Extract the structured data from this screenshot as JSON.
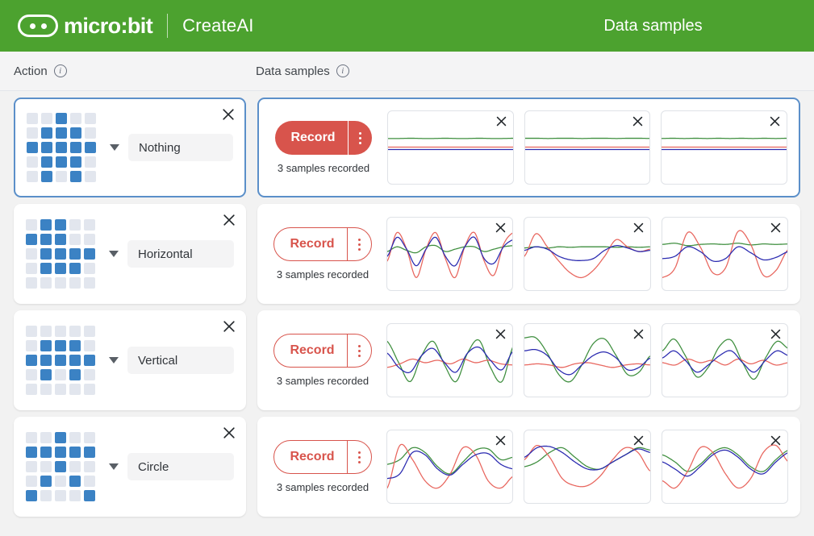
{
  "header": {
    "brand_name": "micro:bit",
    "brand_sub": "CreateAI",
    "page_title": "Data samples",
    "logo_icon": "microbit-logo-icon",
    "bg_color": "#4ca22f"
  },
  "columns": {
    "action_label": "Action",
    "samples_label": "Data samples",
    "info_icon": "info-icon",
    "info_glyph": "i"
  },
  "colors": {
    "led_on": "#3b82c4",
    "led_off": "#e2e6ee",
    "record_red": "#d8544c",
    "selected_border": "#5b8fc9",
    "trace_x": "#e8665e",
    "trace_y": "#3f8f3f",
    "trace_z": "#2a2ab0"
  },
  "close_icon": "close-icon",
  "menu_icon": "kebab-menu-icon",
  "caret_icon": "chevron-down-icon",
  "rows": [
    {
      "label": "Nothing",
      "selected": true,
      "record_label": "Record",
      "record_style": "filled",
      "samples_count": "3 samples recorded",
      "led": [
        [
          0,
          0,
          1,
          0,
          0
        ],
        [
          0,
          1,
          1,
          1,
          0
        ],
        [
          1,
          1,
          1,
          1,
          1
        ],
        [
          0,
          1,
          1,
          1,
          0
        ],
        [
          0,
          1,
          0,
          1,
          0
        ]
      ],
      "samples": [
        {
          "type": "flat"
        },
        {
          "type": "flat"
        },
        {
          "type": "flat"
        }
      ]
    },
    {
      "label": "Horizontal",
      "selected": false,
      "record_label": "Record",
      "record_style": "outline",
      "samples_count": "3 samples recorded",
      "led": [
        [
          0,
          1,
          1,
          0,
          0
        ],
        [
          1,
          1,
          1,
          0,
          0
        ],
        [
          0,
          1,
          1,
          1,
          1
        ],
        [
          0,
          1,
          1,
          1,
          0
        ],
        [
          0,
          0,
          0,
          0,
          0
        ]
      ],
      "samples": [
        {
          "type": "wave",
          "variant": 1
        },
        {
          "type": "wave",
          "variant": 2
        },
        {
          "type": "wave",
          "variant": 3
        }
      ]
    },
    {
      "label": "Vertical",
      "selected": false,
      "record_label": "Record",
      "record_style": "outline",
      "samples_count": "3 samples recorded",
      "led": [
        [
          0,
          0,
          0,
          0,
          0
        ],
        [
          0,
          1,
          1,
          1,
          0
        ],
        [
          1,
          1,
          1,
          1,
          1
        ],
        [
          0,
          1,
          0,
          1,
          0
        ],
        [
          0,
          0,
          0,
          0,
          0
        ]
      ],
      "samples": [
        {
          "type": "wave",
          "variant": 4
        },
        {
          "type": "wave",
          "variant": 5
        },
        {
          "type": "wave",
          "variant": 6
        }
      ]
    },
    {
      "label": "Circle",
      "selected": false,
      "record_label": "Record",
      "record_style": "outline",
      "samples_count": "3 samples recorded",
      "led": [
        [
          0,
          0,
          1,
          0,
          0
        ],
        [
          1,
          1,
          1,
          1,
          1
        ],
        [
          0,
          0,
          1,
          0,
          0
        ],
        [
          0,
          1,
          0,
          1,
          0
        ],
        [
          1,
          0,
          0,
          0,
          1
        ]
      ],
      "samples": [
        {
          "type": "wave",
          "variant": 7
        },
        {
          "type": "wave",
          "variant": 8
        },
        {
          "type": "wave",
          "variant": 9
        }
      ]
    }
  ],
  "chart_data": {
    "type": "line",
    "description": "Accelerometer sample traces, three axes per sample card",
    "series_names": [
      "x",
      "y",
      "z"
    ],
    "series_colors": [
      "#e8665e",
      "#3f8f3f",
      "#2a2ab0"
    ],
    "xlabel": "",
    "ylabel": "",
    "grid": false,
    "legend": "none",
    "cards": [
      {
        "row": "Nothing",
        "index": 0,
        "series": [
          {
            "name": "x",
            "values": [
              0.02,
              0.02,
              0.02,
              0.02,
              0.02,
              0.02,
              0.02,
              0.02,
              0.02,
              0.02,
              0.02,
              0.02
            ]
          },
          {
            "name": "y",
            "values": [
              0.44,
              0.44,
              0.45,
              0.44,
              0.44,
              0.45,
              0.44,
              0.44,
              0.45,
              0.44,
              0.44,
              0.45
            ]
          },
          {
            "name": "z",
            "values": [
              -0.1,
              -0.1,
              -0.1,
              -0.1,
              -0.1,
              -0.1,
              -0.1,
              -0.1,
              -0.1,
              -0.1,
              -0.1,
              -0.1
            ]
          }
        ]
      },
      {
        "row": "Nothing",
        "index": 1,
        "series": [
          {
            "name": "x",
            "values": [
              0.02,
              0.02,
              0.02,
              0.02,
              0.02,
              0.02,
              0.02,
              0.02,
              0.02,
              0.02,
              0.02,
              0.02
            ]
          },
          {
            "name": "y",
            "values": [
              0.45,
              0.45,
              0.44,
              0.45,
              0.45,
              0.44,
              0.45,
              0.45,
              0.44,
              0.45,
              0.45,
              0.44
            ]
          },
          {
            "name": "z",
            "values": [
              -0.1,
              -0.1,
              -0.1,
              -0.1,
              -0.1,
              -0.1,
              -0.1,
              -0.1,
              -0.1,
              -0.1,
              -0.1,
              -0.1
            ]
          }
        ]
      },
      {
        "row": "Nothing",
        "index": 2,
        "series": [
          {
            "name": "x",
            "values": [
              0.02,
              0.02,
              0.02,
              0.02,
              0.02,
              0.02,
              0.02,
              0.02,
              0.02,
              0.02,
              0.02,
              0.02
            ]
          },
          {
            "name": "y",
            "values": [
              0.44,
              0.45,
              0.44,
              0.45,
              0.44,
              0.45,
              0.44,
              0.45,
              0.44,
              0.45,
              0.44,
              0.45
            ]
          },
          {
            "name": "z",
            "values": [
              -0.1,
              -0.1,
              -0.1,
              -0.1,
              -0.1,
              -0.1,
              -0.1,
              -0.1,
              -0.1,
              -0.1,
              -0.1,
              -0.1
            ]
          }
        ]
      },
      {
        "row": "Horizontal",
        "index": 0,
        "series": [
          {
            "name": "x",
            "values": [
              -0.3,
              0.9,
              0.2,
              -1.0,
              0.2,
              0.9,
              -0.2,
              -1.0,
              0.3,
              0.9,
              -0.3,
              -0.9,
              0.4,
              0.9
            ]
          },
          {
            "name": "y",
            "values": [
              0.1,
              0.3,
              0.15,
              0.05,
              0.3,
              0.35,
              0.1,
              0.2,
              0.3,
              0.3,
              0.1,
              0.2,
              0.3,
              0.35
            ]
          },
          {
            "name": "z",
            "values": [
              -0.1,
              0.7,
              0.2,
              -0.5,
              0.2,
              0.7,
              -0.1,
              -0.5,
              0.3,
              0.7,
              -0.2,
              -0.4,
              0.3,
              0.6
            ]
          }
        ]
      },
      {
        "row": "Horizontal",
        "index": 1,
        "series": [
          {
            "name": "x",
            "values": [
              -0.1,
              0.85,
              0.3,
              -0.3,
              -0.8,
              -1.0,
              -0.7,
              -0.1,
              0.6,
              0.3,
              0.1,
              0.2
            ]
          },
          {
            "name": "y",
            "values": [
              0.25,
              0.3,
              0.25,
              0.3,
              0.28,
              0.3,
              0.3,
              0.3,
              0.28,
              0.3,
              0.28,
              0.3
            ]
          },
          {
            "name": "z",
            "values": [
              0.15,
              0.3,
              0.2,
              -0.1,
              -0.25,
              -0.28,
              -0.2,
              0.15,
              0.35,
              0.25,
              0.1,
              0.15
            ]
          }
        ]
      },
      {
        "row": "Horizontal",
        "index": 2,
        "series": [
          {
            "name": "x",
            "values": [
              -1.0,
              -0.6,
              0.9,
              0.3,
              -0.8,
              -0.6,
              0.95,
              0.4,
              -0.9,
              -0.7,
              0.2
            ]
          },
          {
            "name": "y",
            "values": [
              0.4,
              0.45,
              0.35,
              0.4,
              0.42,
              0.4,
              0.45,
              0.38,
              0.42,
              0.4,
              0.42
            ]
          },
          {
            "name": "z",
            "values": [
              -0.2,
              -0.1,
              0.3,
              0.1,
              -0.3,
              -0.2,
              0.3,
              0.05,
              -0.25,
              -0.15,
              0.1
            ]
          }
        ]
      },
      {
        "row": "Vertical",
        "index": 0,
        "series": [
          {
            "name": "x",
            "values": [
              -0.3,
              -0.15,
              0.05,
              -0.1,
              0.0,
              -0.15,
              0.05,
              -0.1,
              0.0,
              -0.15,
              -0.2
            ]
          },
          {
            "name": "y",
            "values": [
              0.8,
              -0.1,
              -0.9,
              0.2,
              0.8,
              -0.2,
              -0.9,
              0.3,
              0.85,
              -0.3,
              -0.9,
              0.6
            ]
          },
          {
            "name": "z",
            "values": [
              0.3,
              -0.3,
              -0.5,
              0.2,
              0.5,
              -0.1,
              -0.5,
              0.3,
              0.55,
              0.0,
              -0.4,
              0.4
            ]
          }
        ]
      },
      {
        "row": "Vertical",
        "index": 1,
        "series": [
          {
            "name": "x",
            "values": [
              -0.2,
              -0.15,
              -0.2,
              -0.3,
              -0.15,
              -0.1,
              -0.2,
              -0.3,
              -0.2,
              -0.15,
              -0.2
            ]
          },
          {
            "name": "y",
            "values": [
              0.95,
              0.95,
              0.3,
              -0.6,
              -0.9,
              -0.2,
              0.7,
              0.9,
              0.2,
              -0.6,
              -0.5,
              0.2
            ]
          },
          {
            "name": "z",
            "values": [
              0.4,
              0.45,
              0.2,
              -0.4,
              -0.6,
              -0.2,
              0.2,
              0.35,
              0.1,
              -0.4,
              -0.3,
              0.1
            ]
          }
        ]
      },
      {
        "row": "Vertical",
        "index": 2,
        "series": [
          {
            "name": "x",
            "values": [
              -0.1,
              -0.2,
              0.05,
              -0.1,
              0.0,
              -0.2,
              0.05,
              -0.15,
              0.0,
              -0.2,
              -0.1
            ]
          },
          {
            "name": "y",
            "values": [
              0.4,
              0.9,
              0.2,
              -0.7,
              -0.3,
              0.6,
              0.85,
              -0.1,
              -0.8,
              0.1,
              0.8,
              0.5
            ]
          },
          {
            "name": "z",
            "values": [
              0.1,
              0.4,
              0.0,
              -0.5,
              -0.2,
              0.2,
              0.4,
              -0.1,
              -0.5,
              0.0,
              0.4,
              0.2
            ]
          }
        ]
      },
      {
        "row": "Circle",
        "index": 0,
        "series": [
          {
            "name": "x",
            "values": [
              -0.9,
              0.9,
              0.3,
              -0.6,
              -0.9,
              -0.3,
              0.8,
              0.5,
              -0.6,
              -0.9,
              -0.4
            ]
          },
          {
            "name": "y",
            "values": [
              0.1,
              0.3,
              0.8,
              0.6,
              0.0,
              -0.3,
              0.2,
              0.7,
              0.75,
              0.3,
              0.4
            ]
          },
          {
            "name": "z",
            "values": [
              -0.5,
              -0.3,
              0.6,
              0.5,
              -0.1,
              -0.35,
              0.1,
              0.5,
              0.55,
              0.1,
              -0.1
            ]
          }
        ]
      },
      {
        "row": "Circle",
        "index": 1,
        "series": [
          {
            "name": "x",
            "values": [
              0.3,
              0.9,
              0.4,
              -0.5,
              -0.8,
              -0.8,
              -0.4,
              0.3,
              0.8,
              0.6,
              -0.2
            ]
          },
          {
            "name": "y",
            "values": [
              0.0,
              0.2,
              0.6,
              0.8,
              0.4,
              0.0,
              -0.1,
              0.2,
              0.5,
              0.8,
              0.7
            ]
          },
          {
            "name": "z",
            "values": [
              0.4,
              0.8,
              0.85,
              0.6,
              0.2,
              -0.1,
              -0.1,
              0.2,
              0.5,
              0.75,
              0.6
            ]
          }
        ]
      },
      {
        "row": "Circle",
        "index": 2,
        "series": [
          {
            "name": "x",
            "values": [
              -0.6,
              -0.9,
              -0.2,
              0.8,
              0.6,
              -0.3,
              -0.9,
              -0.5,
              0.6,
              0.9,
              0.2
            ]
          },
          {
            "name": "y",
            "values": [
              0.5,
              0.2,
              -0.2,
              0.1,
              0.6,
              0.8,
              0.5,
              0.0,
              -0.2,
              0.3,
              0.7
            ]
          },
          {
            "name": "z",
            "values": [
              0.2,
              -0.1,
              -0.4,
              0.0,
              0.5,
              0.7,
              0.4,
              -0.1,
              -0.3,
              0.2,
              0.6
            ]
          }
        ]
      }
    ]
  }
}
